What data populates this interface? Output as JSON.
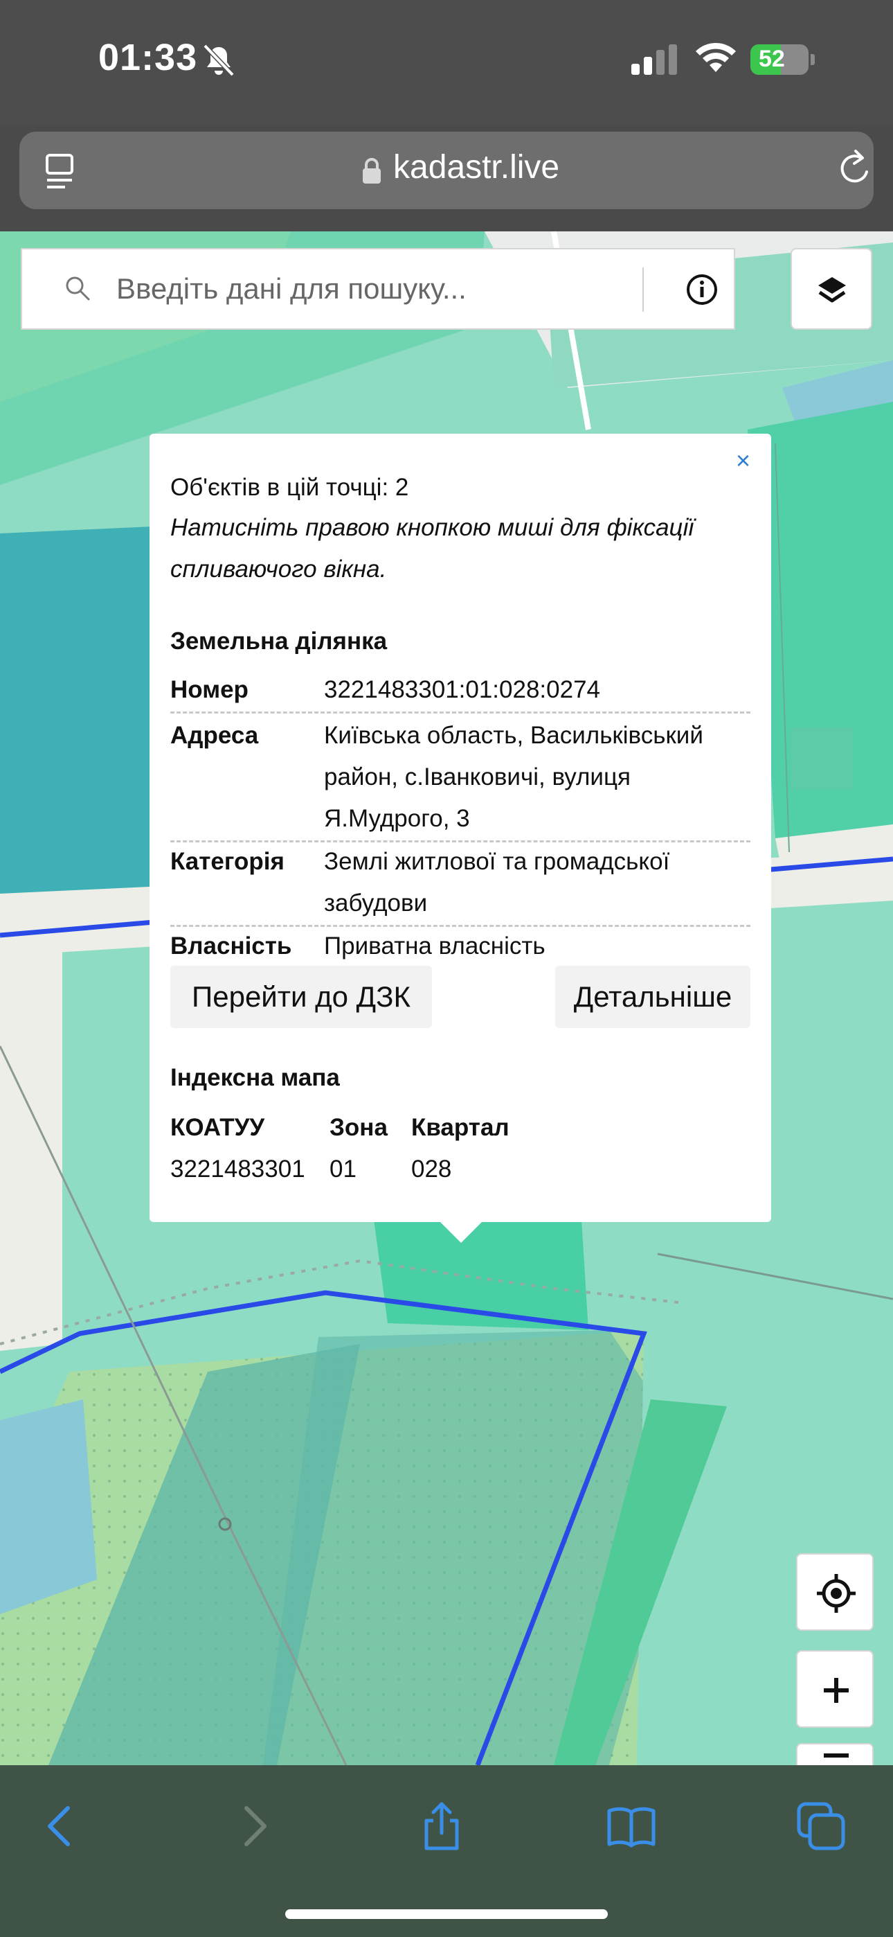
{
  "status_bar": {
    "time": "01:33",
    "battery_percent": "52",
    "battery_level": 0.52,
    "icons": [
      "bell-slash-icon",
      "cellular-signal-icon",
      "wifi-icon",
      "battery-charging-icon"
    ]
  },
  "browser": {
    "url": "kadastr.live",
    "icons": [
      "reader-menu-icon",
      "lock-icon",
      "reload-icon"
    ]
  },
  "search": {
    "placeholder": "Введіть дані для пошуку...",
    "icons": [
      "search-icon",
      "info-icon",
      "layers-icon"
    ]
  },
  "popup": {
    "close": "×",
    "objects_count": "Об'єктів в цій точці: 2",
    "hint": "Натисніть правою кнопкою миші для фіксації спливаючого вікна.",
    "parcel_title": "Земельна ділянка",
    "properties": [
      {
        "key": "Номер",
        "value": "3221483301:01:028:0274"
      },
      {
        "key": "Адреса",
        "value": "Київська область, Васильківський район, с.Іванковичі, вулиця Я.Мудрого, 3"
      },
      {
        "key": "Категорія",
        "value": "Землі житлової та громадської забудови"
      },
      {
        "key": "Власність",
        "value": "Приватна власність"
      }
    ],
    "buttons": {
      "go_dzk": "Перейти до ДЗК",
      "details": "Детальніше"
    },
    "index_title": "Індексна мапа",
    "index_headers": [
      "КОАТУУ",
      "Зона",
      "Квартал"
    ],
    "index_values": [
      "3221483301",
      "01",
      "028"
    ]
  },
  "map_controls": {
    "icons": [
      "locate-icon",
      "zoom-in-icon",
      "zoom-out-icon"
    ]
  },
  "toolbar": {
    "icons": [
      "back-icon",
      "forward-icon",
      "share-icon",
      "bookmarks-icon",
      "tabs-icon"
    ]
  },
  "colors": {
    "accent_blue": "#1f6fe0",
    "parcel_green": "#4fd1a6",
    "parcel_light": "#8fdcc5",
    "parcel_teal": "#3cb3b6",
    "road_gray": "#efefe9",
    "boundary_blue": "#2d4de0",
    "toolbar_icon_blue": "#3a8ee8"
  }
}
